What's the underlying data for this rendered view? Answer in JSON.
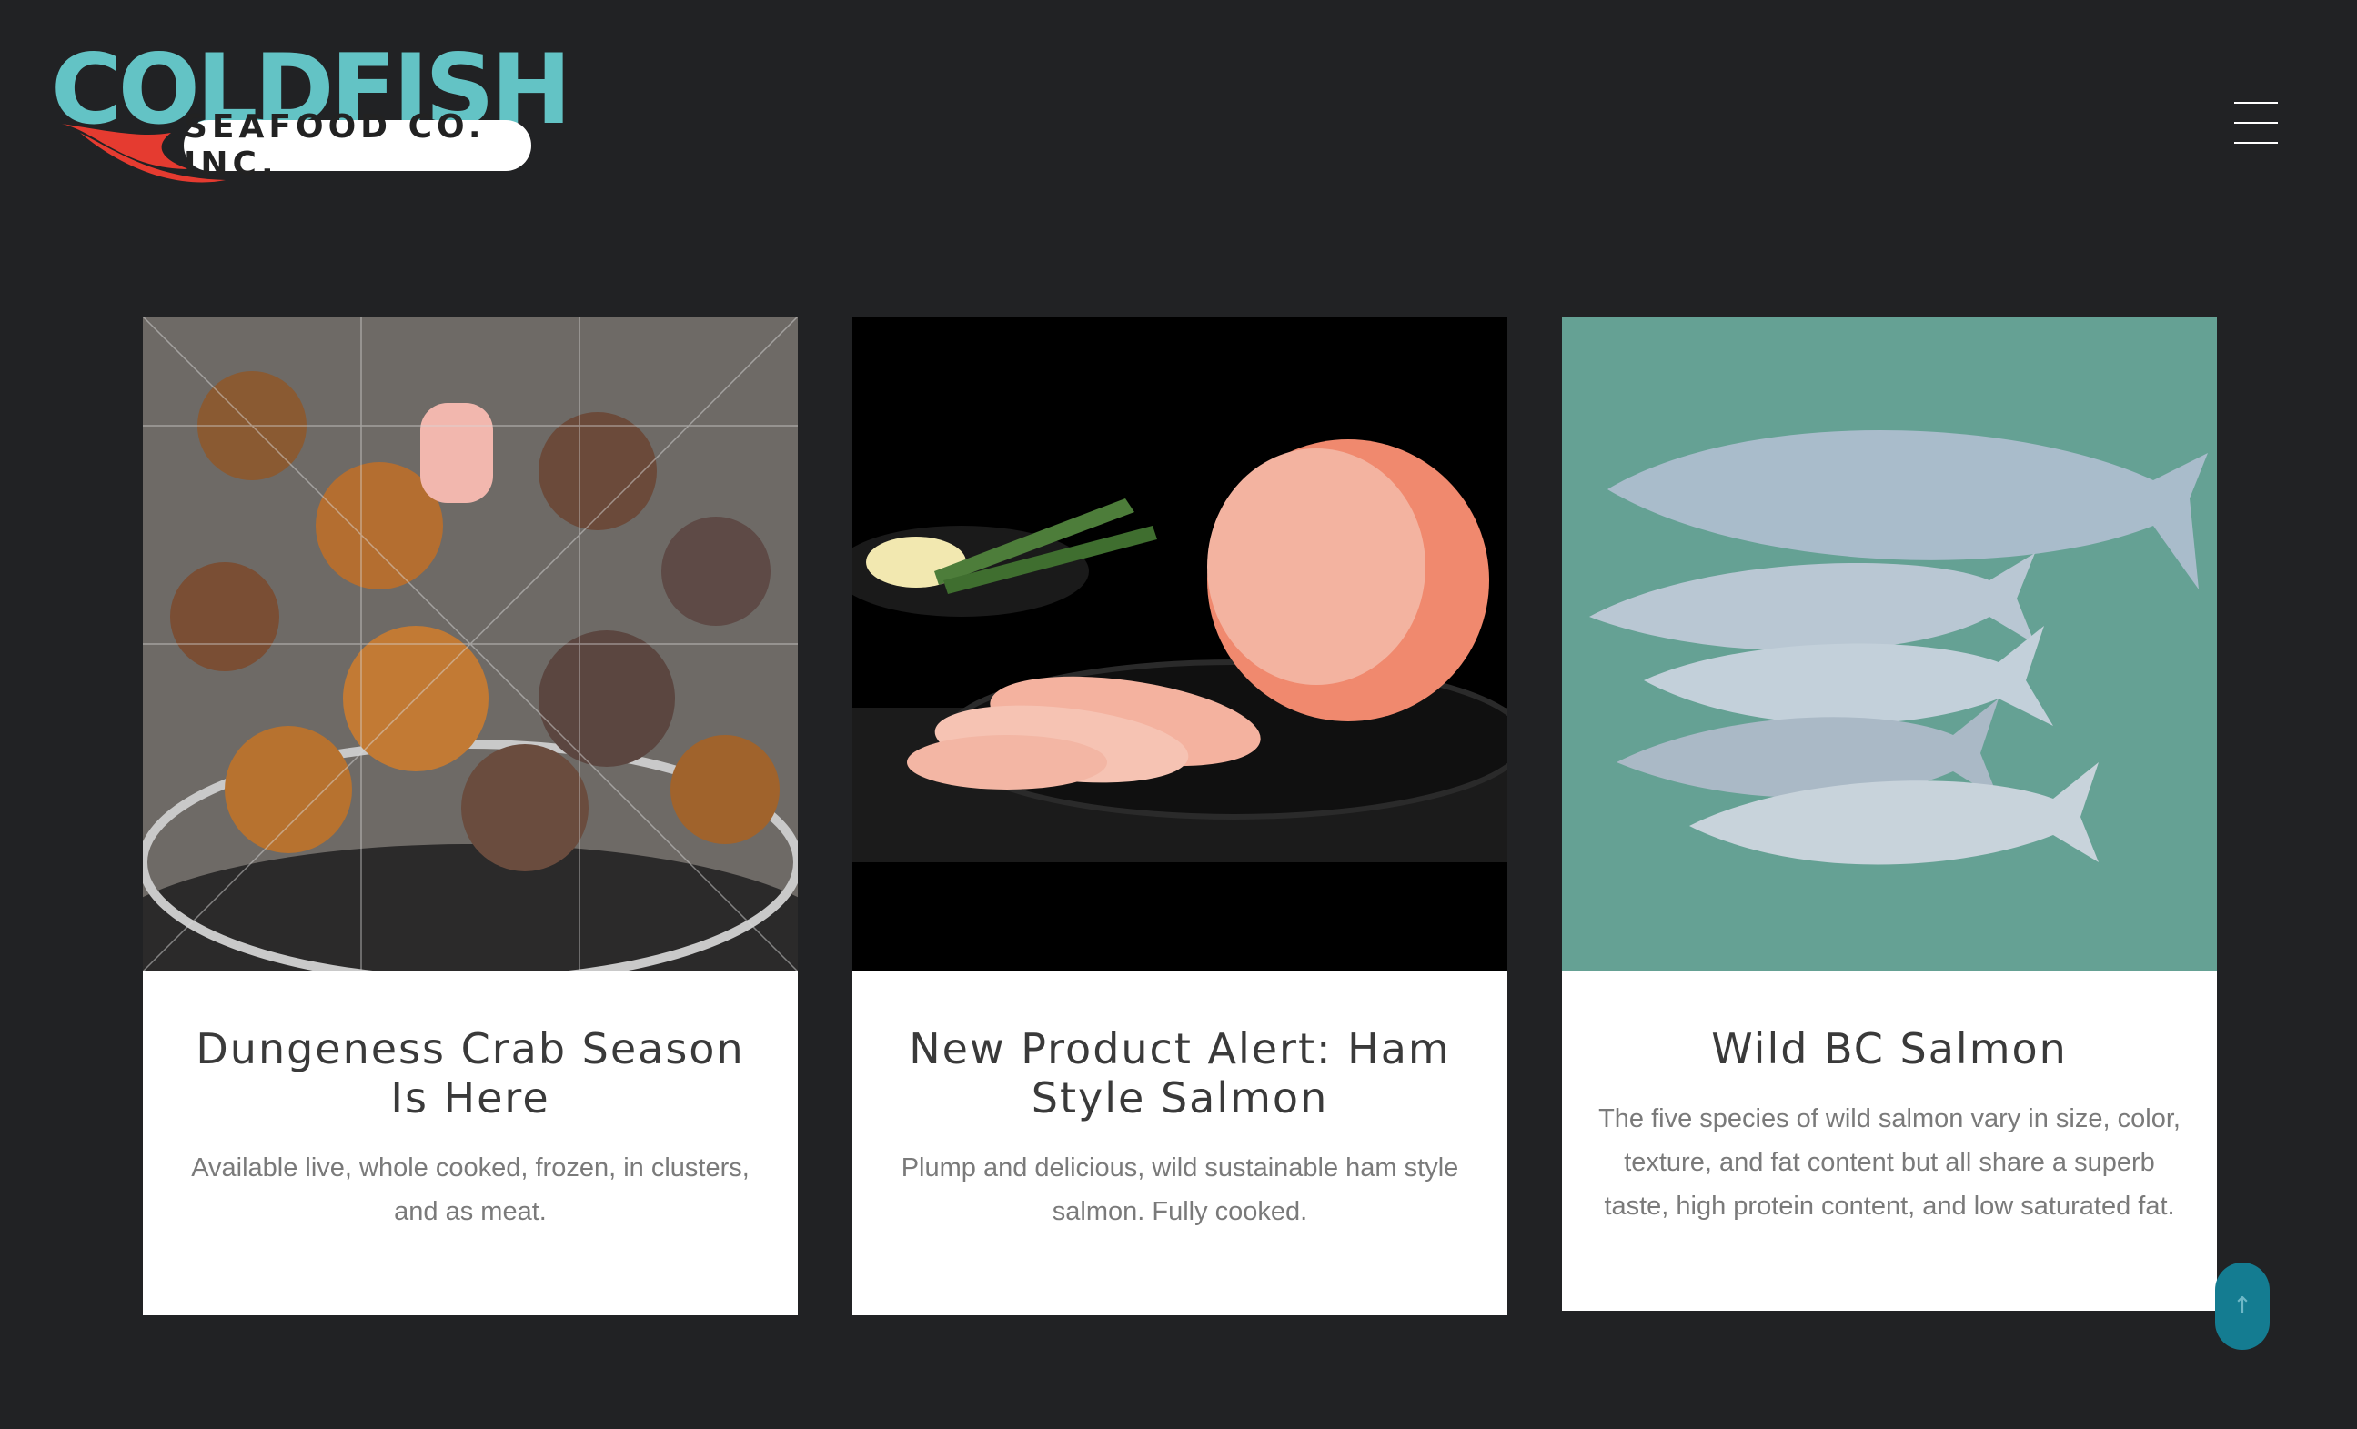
{
  "brand": {
    "name": "COLDFISH",
    "tagline": "SEAFOOD CO. INC."
  },
  "nav": {
    "menu_icon": "hamburger-menu-icon"
  },
  "cards": [
    {
      "title": "Dungeness Crab Season Is Here",
      "text": "Available live, whole cooked, frozen, in clusters, and as meat."
    },
    {
      "title": "New Product Alert: Ham Style Salmon",
      "text": "Plump and delicious, wild sustainable ham style salmon. Fully cooked."
    },
    {
      "title": "Wild BC Salmon",
      "text": "The five species of wild salmon vary in size, color, texture, and fat content but all share a superb taste, high protein content, and low saturated fat."
    }
  ],
  "back_to_top": {
    "icon": "arrow-up-icon",
    "glyph": "↑"
  },
  "colors": {
    "background": "#212224",
    "brand_teal": "#63c3c5",
    "brand_red": "#e53b30",
    "button_teal": "#147c91"
  }
}
